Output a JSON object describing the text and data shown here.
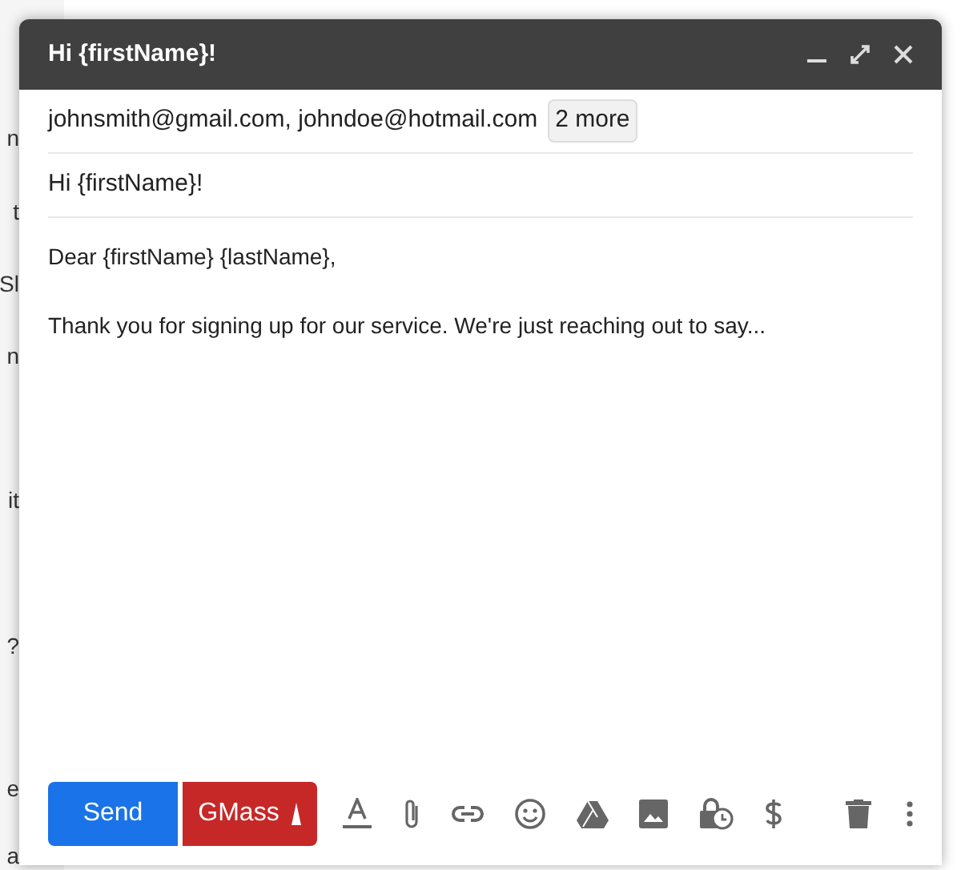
{
  "background_texts": [
    "n",
    "t",
    "Sl",
    "n",
    "it",
    "?",
    "e",
    "a"
  ],
  "window": {
    "title": "Hi {firstName}!"
  },
  "recipients": {
    "addresses": "johnsmith@gmail.com, johndoe@hotmail.com",
    "more": "2 more"
  },
  "subject": "Hi {firstName}!",
  "body": [
    "Dear {firstName} {lastName},",
    "Thank you for signing up for our service. We're just reaching out to say..."
  ],
  "buttons": {
    "send": "Send",
    "gmass": "GMass"
  }
}
